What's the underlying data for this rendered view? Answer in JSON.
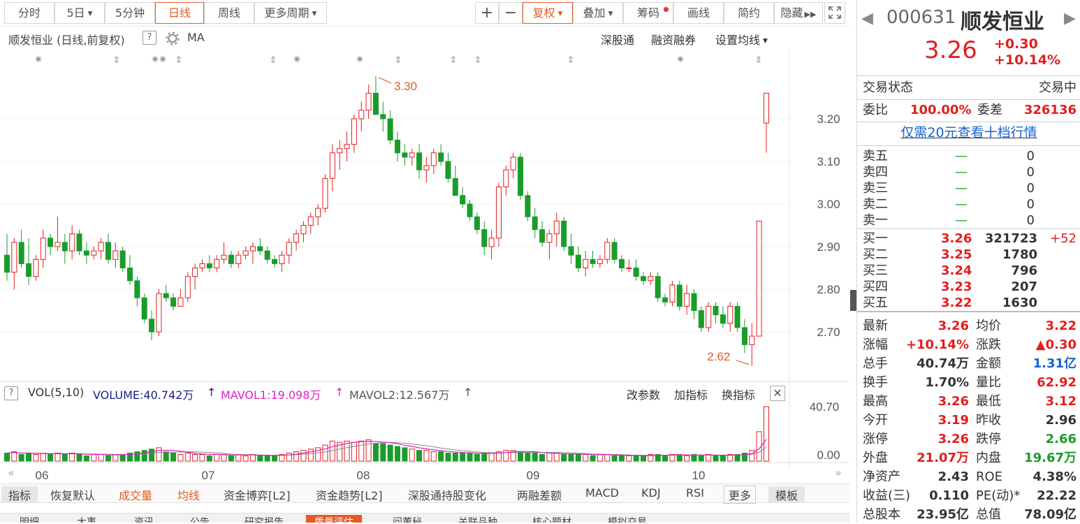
{
  "toolbar": {
    "periods": [
      "分时",
      "5日",
      "5分钟",
      "日线",
      "周线",
      "更多周期"
    ],
    "active_period": "日线",
    "right_buttons": [
      "复权",
      "叠加",
      "筹码",
      "画线",
      "简约",
      "隐藏"
    ]
  },
  "subheader": {
    "title": "顺发恒业 (日线,前复权)",
    "ma_label": "MA",
    "links": [
      "深股通",
      "融资融券",
      "设置均线"
    ]
  },
  "volume_header": {
    "name": "VOL(5,10)",
    "volume": "VOLUME:40.742万",
    "mavol1": "MAVOL1:19.098万",
    "mavol2": "MAVOL2:12.567万",
    "actions": [
      "改参数",
      "加指标",
      "换指标"
    ]
  },
  "price_axis": [
    "3.20",
    "3.10",
    "3.00",
    "2.90",
    "2.80",
    "2.70"
  ],
  "vol_axis": [
    "40.70",
    "0.00"
  ],
  "month_labels": [
    "06",
    "07",
    "08",
    "09",
    "10"
  ],
  "annotations": {
    "high": "3.30",
    "low": "2.62"
  },
  "bottom_tabs": [
    "指标",
    "恢复默认",
    "成交量",
    "均线",
    "资金博弈[L2]",
    "资金趋势[L2]",
    "深股通持股变化",
    "两融差额",
    "MACD",
    "KDJ",
    "RSI",
    "更多",
    "模板"
  ],
  "bottom_tabs2": [
    "明细",
    "大事",
    "资讯",
    "公告",
    "研究报告",
    "质量评估",
    "问董秘",
    "关联品种",
    "核心题材",
    "模拟交易"
  ],
  "quote": {
    "code": "000631",
    "name": "顺发恒业",
    "price": "3.26",
    "change": "+0.30",
    "change_pct": "+10.14%",
    "status_label": "交易状态",
    "status_value": "交易中",
    "weibi_label": "委比",
    "weibi_value": "100.00%",
    "weicha_label": "委差",
    "weicha_value": "326136",
    "level10_link": "仅需20元查看十档行情"
  },
  "order_book": {
    "asks": [
      {
        "label": "卖五",
        "price": "—",
        "vol": "0"
      },
      {
        "label": "卖四",
        "price": "—",
        "vol": "0"
      },
      {
        "label": "卖三",
        "price": "—",
        "vol": "0"
      },
      {
        "label": "卖二",
        "price": "—",
        "vol": "0"
      },
      {
        "label": "卖一",
        "price": "—",
        "vol": "0"
      }
    ],
    "bids": [
      {
        "label": "买一",
        "price": "3.26",
        "vol": "321723",
        "extra": "+52"
      },
      {
        "label": "买二",
        "price": "3.25",
        "vol": "1780",
        "extra": ""
      },
      {
        "label": "买三",
        "price": "3.24",
        "vol": "796",
        "extra": ""
      },
      {
        "label": "买四",
        "price": "3.23",
        "vol": "207",
        "extra": ""
      },
      {
        "label": "买五",
        "price": "3.22",
        "vol": "1630",
        "extra": ""
      }
    ]
  },
  "stats": [
    {
      "l1": "最新",
      "v1": "3.26",
      "c1": "red",
      "l2": "均价",
      "v2": "3.22",
      "c2": "red"
    },
    {
      "l1": "涨幅",
      "v1": "+10.14%",
      "c1": "red",
      "l2": "涨跌",
      "v2": "▲0.30",
      "c2": "red"
    },
    {
      "l1": "总手",
      "v1": "40.74万",
      "c1": "",
      "l2": "金额",
      "v2": "1.31亿",
      "c2": "blue"
    },
    {
      "l1": "换手",
      "v1": "1.70%",
      "c1": "",
      "l2": "量比",
      "v2": "62.92",
      "c2": "red"
    },
    {
      "l1": "最高",
      "v1": "3.26",
      "c1": "red",
      "l2": "最低",
      "v2": "3.12",
      "c2": "red"
    },
    {
      "l1": "今开",
      "v1": "3.19",
      "c1": "red",
      "l2": "昨收",
      "v2": "2.96",
      "c2": ""
    },
    {
      "l1": "涨停",
      "v1": "3.26",
      "c1": "red",
      "l2": "跌停",
      "v2": "2.66",
      "c2": "green"
    },
    {
      "l1": "外盘",
      "v1": "21.07万",
      "c1": "red",
      "l2": "内盘",
      "v2": "19.67万",
      "c2": "green"
    },
    {
      "l1": "净资产",
      "v1": "2.43",
      "c1": "",
      "l2": "ROE",
      "v2": "4.38%",
      "c2": ""
    },
    {
      "l1": "收益(三)",
      "v1": "0.110",
      "c1": "",
      "l2": "PE(动)*",
      "v2": "22.22",
      "c2": ""
    },
    {
      "l1": "总股本",
      "v1": "23.95亿",
      "c1": "",
      "l2": "总值",
      "v2": "78.09亿",
      "c2": ""
    }
  ],
  "colors": {
    "up": "#e21e1e",
    "down": "#1a9c2a",
    "accent": "#e35a25"
  },
  "chart_data": {
    "type": "candlestick",
    "title": "顺发恒业 (日线,前复权)",
    "ylim": [
      2.6,
      3.33
    ],
    "x_ticks": [
      "06",
      "07",
      "08",
      "09",
      "10"
    ],
    "ohlc": [
      [
        2.88,
        2.93,
        2.82,
        2.84
      ],
      [
        2.84,
        2.92,
        2.8,
        2.91
      ],
      [
        2.91,
        2.94,
        2.85,
        2.86
      ],
      [
        2.86,
        2.92,
        2.81,
        2.83
      ],
      [
        2.83,
        2.88,
        2.82,
        2.87
      ],
      [
        2.87,
        2.94,
        2.85,
        2.92
      ],
      [
        2.92,
        2.93,
        2.88,
        2.9
      ],
      [
        2.9,
        2.97,
        2.89,
        2.91
      ],
      [
        2.91,
        2.93,
        2.86,
        2.89
      ],
      [
        2.89,
        2.95,
        2.87,
        2.93
      ],
      [
        2.93,
        2.94,
        2.88,
        2.89
      ],
      [
        2.89,
        2.91,
        2.86,
        2.88
      ],
      [
        2.88,
        2.9,
        2.87,
        2.89
      ],
      [
        2.89,
        2.92,
        2.87,
        2.91
      ],
      [
        2.91,
        2.93,
        2.86,
        2.87
      ],
      [
        2.87,
        2.91,
        2.85,
        2.89
      ],
      [
        2.89,
        2.9,
        2.84,
        2.85
      ],
      [
        2.85,
        2.88,
        2.81,
        2.82
      ],
      [
        2.82,
        2.83,
        2.76,
        2.78
      ],
      [
        2.78,
        2.79,
        2.72,
        2.73
      ],
      [
        2.73,
        2.75,
        2.68,
        2.7
      ],
      [
        2.7,
        2.8,
        2.69,
        2.79
      ],
      [
        2.79,
        2.81,
        2.77,
        2.78
      ],
      [
        2.78,
        2.79,
        2.75,
        2.76
      ],
      [
        2.76,
        2.8,
        2.76,
        2.78
      ],
      [
        2.78,
        2.84,
        2.77,
        2.83
      ],
      [
        2.83,
        2.86,
        2.8,
        2.85
      ],
      [
        2.85,
        2.87,
        2.84,
        2.86
      ],
      [
        2.86,
        2.88,
        2.84,
        2.85
      ],
      [
        2.85,
        2.88,
        2.84,
        2.87
      ],
      [
        2.87,
        2.91,
        2.86,
        2.88
      ],
      [
        2.88,
        2.89,
        2.85,
        2.86
      ],
      [
        2.86,
        2.89,
        2.85,
        2.88
      ],
      [
        2.88,
        2.9,
        2.87,
        2.89
      ],
      [
        2.89,
        2.91,
        2.86,
        2.9
      ],
      [
        2.9,
        2.92,
        2.88,
        2.89
      ],
      [
        2.89,
        2.9,
        2.86,
        2.87
      ],
      [
        2.87,
        2.88,
        2.85,
        2.86
      ],
      [
        2.86,
        2.89,
        2.84,
        2.88
      ],
      [
        2.88,
        2.92,
        2.86,
        2.91
      ],
      [
        2.91,
        2.94,
        2.89,
        2.93
      ],
      [
        2.93,
        2.96,
        2.91,
        2.95
      ],
      [
        2.95,
        2.98,
        2.93,
        2.97
      ],
      [
        2.97,
        3.0,
        2.95,
        2.99
      ],
      [
        2.99,
        3.07,
        2.98,
        3.06
      ],
      [
        3.06,
        3.14,
        3.03,
        3.12
      ],
      [
        3.12,
        3.15,
        3.08,
        3.13
      ],
      [
        3.13,
        3.17,
        3.1,
        3.14
      ],
      [
        3.14,
        3.21,
        3.12,
        3.2
      ],
      [
        3.2,
        3.24,
        3.17,
        3.22
      ],
      [
        3.22,
        3.28,
        3.2,
        3.26
      ],
      [
        3.26,
        3.3,
        3.22,
        3.21
      ],
      [
        3.21,
        3.24,
        3.17,
        3.2
      ],
      [
        3.2,
        3.22,
        3.14,
        3.15
      ],
      [
        3.15,
        3.17,
        3.1,
        3.12
      ],
      [
        3.12,
        3.14,
        3.09,
        3.11
      ],
      [
        3.11,
        3.13,
        3.09,
        3.12
      ],
      [
        3.12,
        3.14,
        3.06,
        3.08
      ],
      [
        3.08,
        3.11,
        3.05,
        3.09
      ],
      [
        3.09,
        3.13,
        3.07,
        3.12
      ],
      [
        3.12,
        3.14,
        3.09,
        3.1
      ],
      [
        3.1,
        3.12,
        3.05,
        3.06
      ],
      [
        3.06,
        3.09,
        3.03,
        3.02
      ],
      [
        3.02,
        3.04,
        2.99,
        3.0
      ],
      [
        3.0,
        3.01,
        2.96,
        2.97
      ],
      [
        2.97,
        2.98,
        2.93,
        2.94
      ],
      [
        2.94,
        2.96,
        2.88,
        2.9
      ],
      [
        2.9,
        2.94,
        2.87,
        2.92
      ],
      [
        2.92,
        3.05,
        2.9,
        3.04
      ],
      [
        3.04,
        3.09,
        3.02,
        3.08
      ],
      [
        3.08,
        3.12,
        3.06,
        3.11
      ],
      [
        3.11,
        3.12,
        3.01,
        3.02
      ],
      [
        3.02,
        3.03,
        2.96,
        2.97
      ],
      [
        2.97,
        2.99,
        2.92,
        2.94
      ],
      [
        2.94,
        2.96,
        2.9,
        2.91
      ],
      [
        2.91,
        2.94,
        2.87,
        2.93
      ],
      [
        2.93,
        2.98,
        2.9,
        2.96
      ],
      [
        2.96,
        2.97,
        2.89,
        2.9
      ],
      [
        2.9,
        2.93,
        2.86,
        2.88
      ],
      [
        2.88,
        2.9,
        2.84,
        2.85
      ],
      [
        2.85,
        2.89,
        2.83,
        2.87
      ],
      [
        2.87,
        2.89,
        2.85,
        2.86
      ],
      [
        2.86,
        2.88,
        2.85,
        2.87
      ],
      [
        2.87,
        2.92,
        2.86,
        2.91
      ],
      [
        2.91,
        2.92,
        2.86,
        2.87
      ],
      [
        2.87,
        2.88,
        2.84,
        2.85
      ],
      [
        2.85,
        2.87,
        2.84,
        2.85
      ],
      [
        2.85,
        2.87,
        2.82,
        2.83
      ],
      [
        2.83,
        2.84,
        2.81,
        2.82
      ],
      [
        2.82,
        2.84,
        2.81,
        2.83
      ],
      [
        2.83,
        2.84,
        2.77,
        2.78
      ],
      [
        2.78,
        2.79,
        2.76,
        2.77
      ],
      [
        2.77,
        2.82,
        2.76,
        2.81
      ],
      [
        2.81,
        2.82,
        2.75,
        2.76
      ],
      [
        2.76,
        2.81,
        2.74,
        2.79
      ],
      [
        2.79,
        2.8,
        2.73,
        2.75
      ],
      [
        2.75,
        2.76,
        2.7,
        2.71
      ],
      [
        2.71,
        2.77,
        2.7,
        2.76
      ],
      [
        2.76,
        2.77,
        2.72,
        2.74
      ],
      [
        2.74,
        2.76,
        2.71,
        2.72
      ],
      [
        2.72,
        2.77,
        2.7,
        2.76
      ],
      [
        2.76,
        2.77,
        2.7,
        2.71
      ],
      [
        2.71,
        2.73,
        2.65,
        2.67
      ],
      [
        2.67,
        2.72,
        2.62,
        2.69
      ],
      [
        2.69,
        2.96,
        2.69,
        2.96
      ],
      [
        3.19,
        3.26,
        3.12,
        3.26
      ]
    ],
    "volume_unit": "万",
    "volume": [
      6,
      7,
      5,
      6,
      5,
      6,
      5,
      6,
      5,
      6,
      5,
      4,
      5,
      5,
      4,
      5,
      5,
      6,
      7,
      8,
      9,
      10,
      7,
      6,
      5,
      6,
      5,
      5,
      4,
      5,
      5,
      4,
      5,
      4,
      5,
      4,
      4,
      4,
      5,
      6,
      7,
      8,
      9,
      10,
      12,
      15,
      14,
      15,
      14,
      15,
      16,
      13,
      13,
      12,
      11,
      10,
      9,
      8,
      8,
      7,
      7,
      6,
      6,
      6,
      6,
      5,
      6,
      6,
      7,
      8,
      8,
      7,
      6,
      6,
      5,
      6,
      6,
      5,
      5,
      5,
      5,
      4,
      5,
      5,
      4,
      4,
      4,
      4,
      4,
      5,
      5,
      4,
      5,
      5,
      4,
      5,
      4,
      5,
      4,
      4,
      5,
      5,
      6,
      8,
      22,
      40.742
    ]
  }
}
